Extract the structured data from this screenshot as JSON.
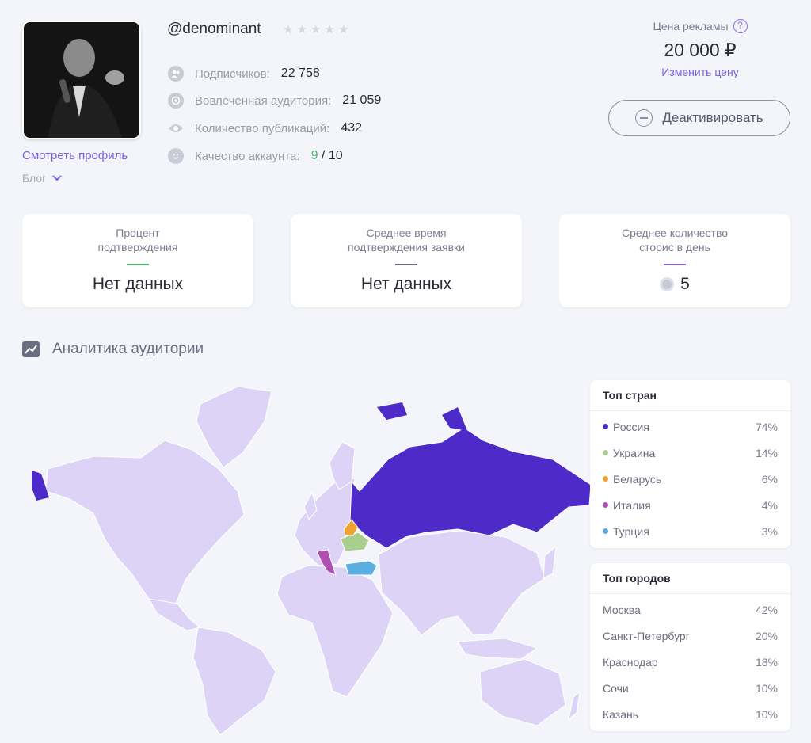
{
  "profile": {
    "username": "@denominant",
    "rating_stars": 5,
    "rating_filled": 0,
    "view_profile_label": "Смотреть профиль",
    "category_label": "Блог"
  },
  "stats": [
    {
      "icon": "followers-icon",
      "label": "Подписчиков:",
      "value": "22 758"
    },
    {
      "icon": "target-icon",
      "label": "Вовлеченная аудитория:",
      "value": "21 059"
    },
    {
      "icon": "eye-icon",
      "label": "Количество публикаций:",
      "value": "432"
    },
    {
      "icon": "smile-icon",
      "label": "Качество аккаунта:",
      "value_good": "9",
      "value_total": "/ 10"
    }
  ],
  "pricing": {
    "label": "Цена рекламы",
    "help_glyph": "?",
    "value": "20 000 ₽",
    "change_label": "Изменить цену",
    "deactivate_label": "Деактивировать"
  },
  "cards": [
    {
      "title_line1": "Процент",
      "title_line2": "подтверждения",
      "value": "Нет данных",
      "accent": "#4db36a"
    },
    {
      "title_line1": "Среднее время",
      "title_line2": "подтверждения заявки",
      "value": "Нет данных",
      "accent": "#6b6e80"
    },
    {
      "title_line1": "Среднее количество",
      "title_line2": "сторис в день",
      "value": "5",
      "accent": "#8b62e0"
    }
  ],
  "analytics": {
    "title": "Аналитика аудитории"
  },
  "top_countries": {
    "title": "Топ стран",
    "items": [
      {
        "name": "Россия",
        "pct": "74%",
        "color": "#4e2bc9"
      },
      {
        "name": "Украина",
        "pct": "14%",
        "color": "#a8cf8e"
      },
      {
        "name": "Беларусь",
        "pct": "6%",
        "color": "#f0a330"
      },
      {
        "name": "Италия",
        "pct": "4%",
        "color": "#b04fb2"
      },
      {
        "name": "Турция",
        "pct": "3%",
        "color": "#5aaee0"
      }
    ]
  },
  "top_cities": {
    "title": "Топ городов",
    "items": [
      {
        "name": "Москва",
        "pct": "42%"
      },
      {
        "name": "Санкт-Петербург",
        "pct": "20%"
      },
      {
        "name": "Краснодар",
        "pct": "18%"
      },
      {
        "name": "Сочи",
        "pct": "10%"
      },
      {
        "name": "Казань",
        "pct": "10%"
      }
    ]
  },
  "colors": {
    "accent": "#7b62d9",
    "map_base": "#dcd3f7",
    "map_border": "#ffffff"
  }
}
